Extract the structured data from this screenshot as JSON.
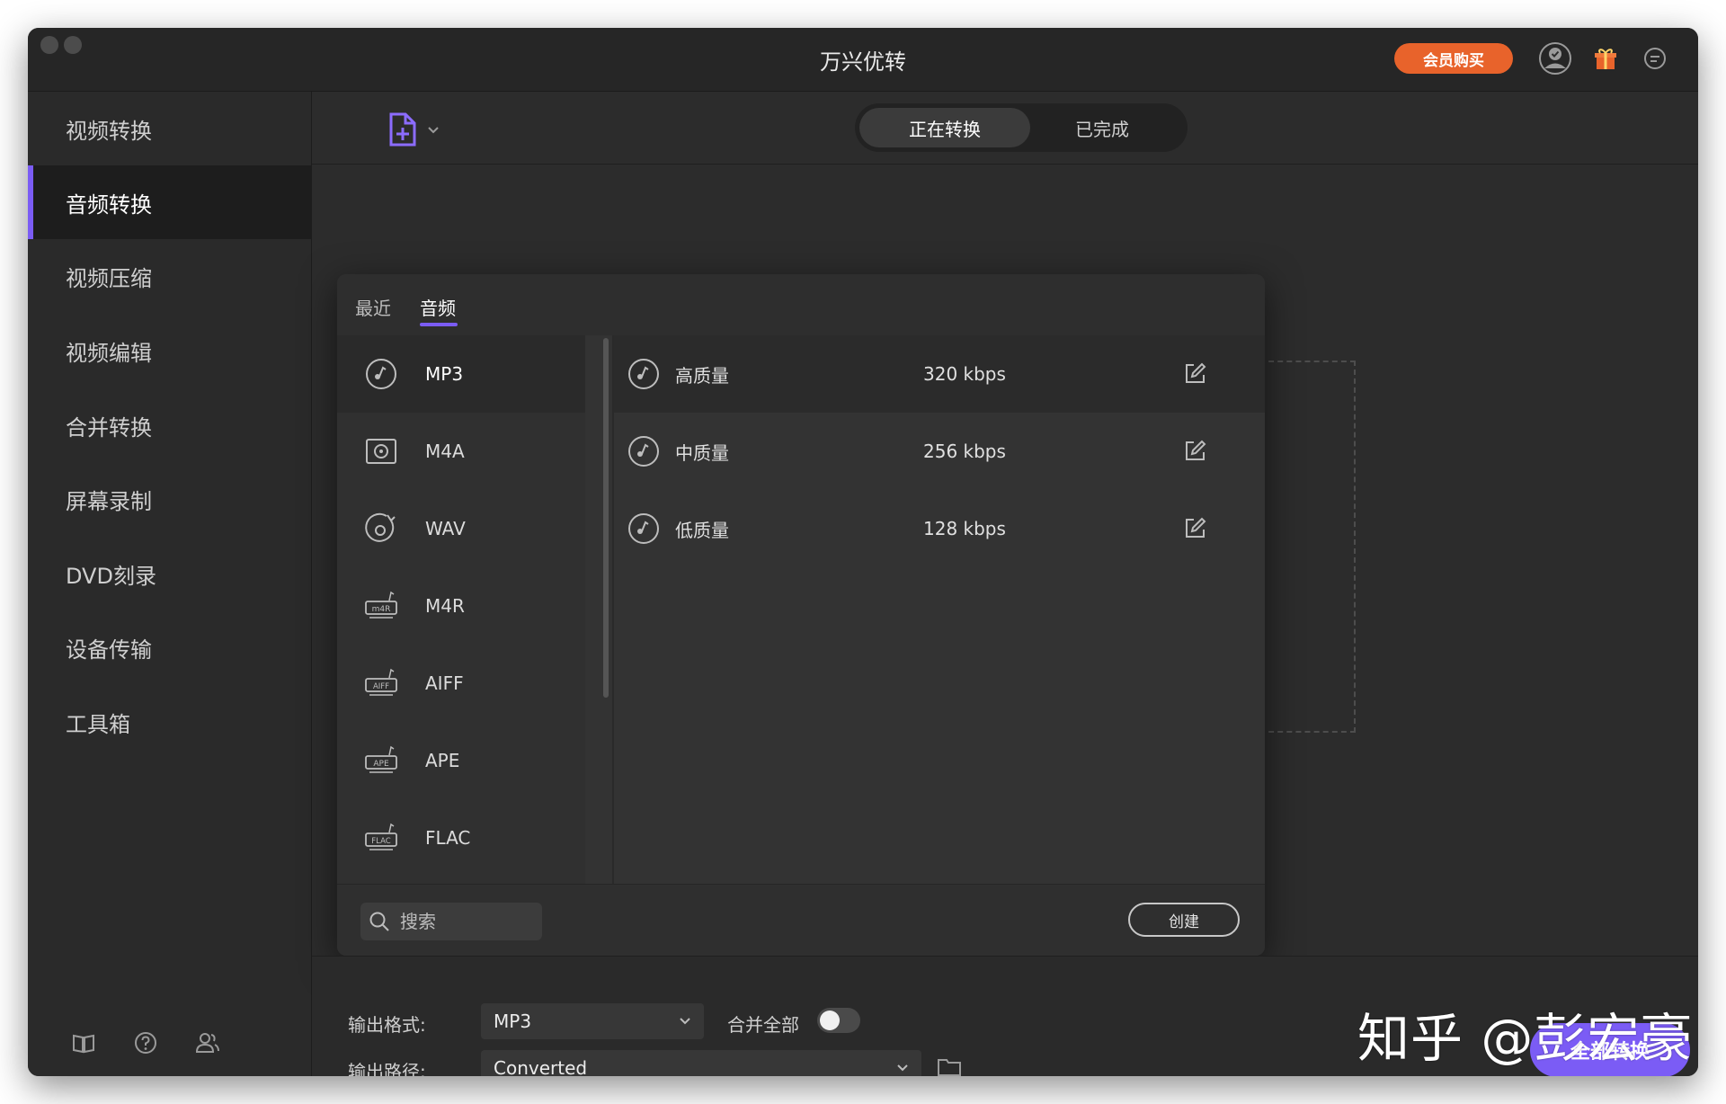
{
  "app": {
    "title": "万兴优转",
    "vip_label": "会员购买"
  },
  "sidebar": {
    "items": [
      {
        "label": "视频转换"
      },
      {
        "label": "音频转换"
      },
      {
        "label": "视频压缩"
      },
      {
        "label": "视频编辑"
      },
      {
        "label": "合并转换"
      },
      {
        "label": "屏幕录制"
      },
      {
        "label": "DVD刻录"
      },
      {
        "label": "设备传输"
      },
      {
        "label": "工具箱"
      }
    ],
    "active_index": 1
  },
  "top_tabs": {
    "converting": "正在转换",
    "completed": "已完成"
  },
  "popup": {
    "tabs": {
      "recent": "最近",
      "audio": "音频"
    },
    "formats": [
      {
        "label": "MP3",
        "icon": "music-disc-icon"
      },
      {
        "label": "M4A",
        "icon": "m4a-file-icon"
      },
      {
        "label": "WAV",
        "icon": "wav-disc-icon"
      },
      {
        "label": "M4R",
        "icon": "m4r-file-icon"
      },
      {
        "label": "AIFF",
        "icon": "aiff-file-icon"
      },
      {
        "label": "APE",
        "icon": "ape-file-icon"
      },
      {
        "label": "FLAC",
        "icon": "flac-file-icon"
      }
    ],
    "qualities": [
      {
        "name": "高质量",
        "rate": "320 kbps"
      },
      {
        "name": "中质量",
        "rate": "256 kbps"
      },
      {
        "name": "低质量",
        "rate": "128 kbps"
      }
    ],
    "search_placeholder": "搜索",
    "create_label": "创建"
  },
  "bottom": {
    "output_format_label": "输出格式:",
    "output_format_value": "MP3",
    "merge_all_label": "合并全部",
    "output_path_label": "输出路径:",
    "output_path_value": "Converted",
    "convert_all_label": "全部转换"
  },
  "watermark": "知乎 @彭宏豪",
  "colors": {
    "accent": "#7b5cf5",
    "vip": "#e8632b"
  }
}
